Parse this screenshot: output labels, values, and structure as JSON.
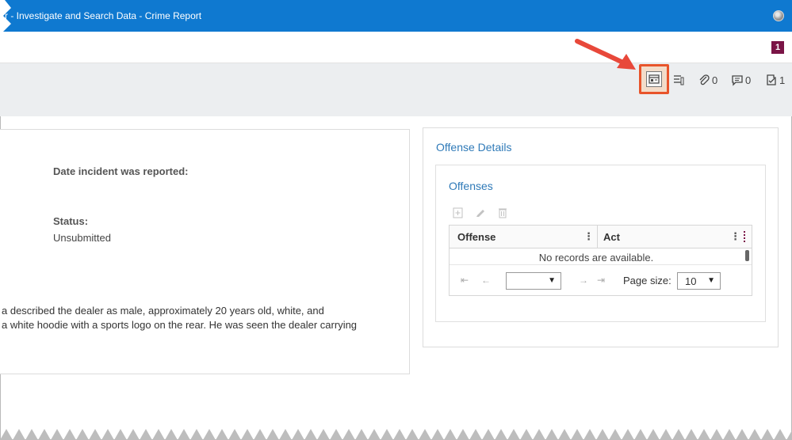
{
  "window": {
    "title": "r - Investigate and Search Data - Crime Report"
  },
  "header": {
    "notification_count": "1"
  },
  "toolbar": {
    "attachments_count": "0",
    "comments_count": "0",
    "tasks_count": "1",
    "icons": [
      "form-view-icon",
      "document-list-icon",
      "paperclip-icon",
      "comment-icon",
      "task-icon"
    ]
  },
  "left_panel": {
    "date_label": "Date incident was reported:",
    "status_label": "Status:",
    "status_value": "Unsubmitted",
    "narrative_line1": "a described the dealer as male, approximately 20 years old, white, and",
    "narrative_line2": "a white hoodie with a sports logo on the rear. He was seen the dealer carrying"
  },
  "right_panel": {
    "section_title": "Offense Details",
    "subsection_title": "Offenses",
    "grid": {
      "columns": [
        "Offense",
        "Act"
      ],
      "empty_message": "No records are available.",
      "page_select_value": "",
      "page_size_label": "Page size:",
      "page_size_value": "10"
    }
  },
  "colors": {
    "titlebar": "#0f79d0",
    "section_title": "#2f7ab8",
    "highlight": "#e8542b",
    "badge": "#7a1446"
  }
}
